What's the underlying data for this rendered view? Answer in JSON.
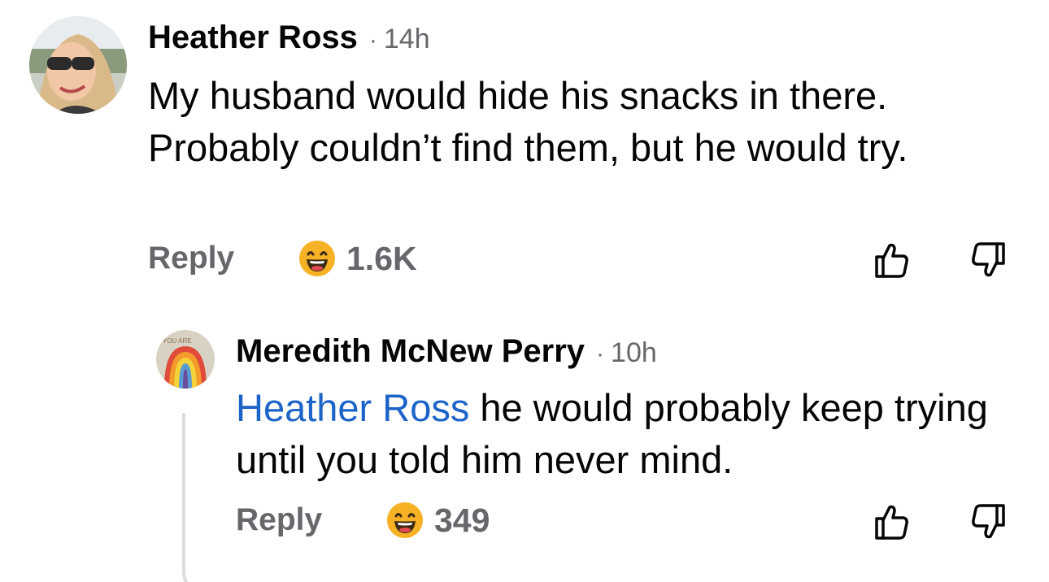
{
  "comments": [
    {
      "author": "Heather Ross",
      "time": "14h",
      "text": "My husband would hide his snacks in there. Probably couldn’t find them, but he would try.",
      "reply_label": "Reply",
      "reaction": {
        "icon": "laughing-emoji-icon",
        "count": "1.6K"
      }
    },
    {
      "author": "Meredith McNew Perry",
      "time": "10h",
      "mention": "Heather Ross",
      "text": " he would probably keep trying until you told him never mind.",
      "reply_label": "Reply",
      "reaction": {
        "icon": "laughing-emoji-icon",
        "count": "349"
      }
    }
  ],
  "meta_separator": "·",
  "icons": {
    "upvote": "thumbs-up-outline-icon",
    "downvote": "thumbs-down-outline-icon"
  },
  "colors": {
    "text": "#050505",
    "secondary": "#65676b",
    "mention": "#1d64c9",
    "thread_line": "#dadde1"
  }
}
